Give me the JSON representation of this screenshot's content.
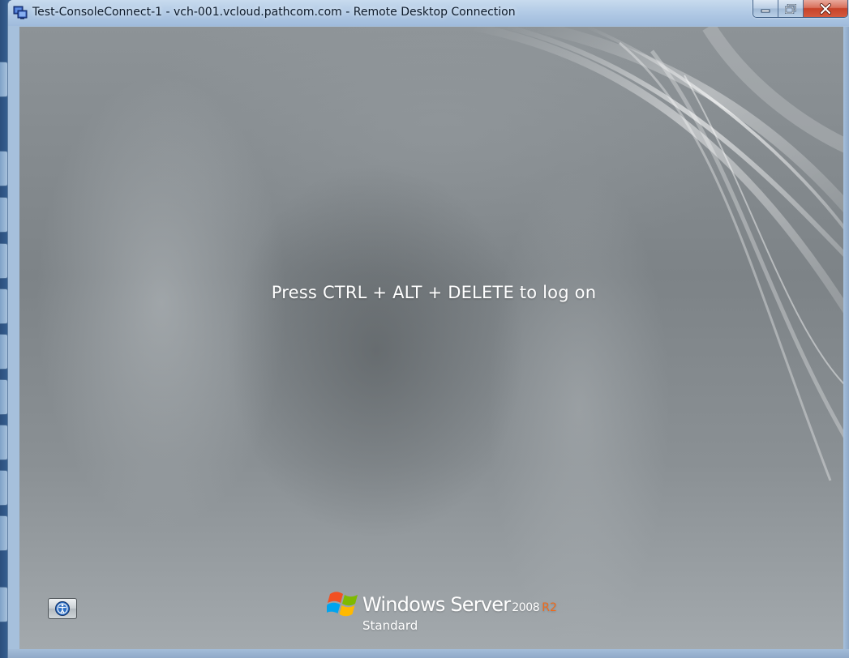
{
  "window": {
    "title": "Test-ConsoleConnect-1 - vch-001.vcloud.pathcom.com - Remote Desktop Connection",
    "icon": "remote-desktop-icon",
    "buttons": {
      "minimize_icon": "minimize-icon",
      "maximize_icon": "restore-icon",
      "close_icon": "close-icon"
    }
  },
  "session": {
    "logon_message": "Press CTRL + ALT + DELETE to log on",
    "ease_of_access_icon": "ease-of-access-icon",
    "branding": {
      "product": "Windows Server",
      "version": "2008",
      "release": "R2",
      "edition": "Standard",
      "release_color": "#f06a1a"
    }
  },
  "colors": {
    "titlebar": "#b3cbe6",
    "close_button": "#c7432a",
    "background_gray": "#7d8387"
  }
}
